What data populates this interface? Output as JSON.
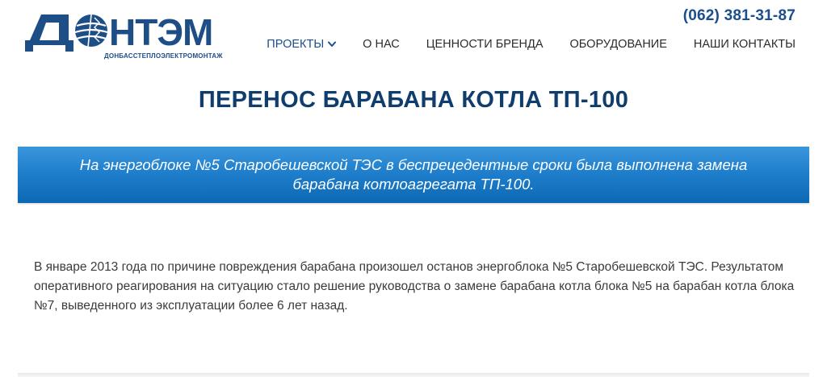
{
  "header": {
    "logo": {
      "wordmark": "ДОНТЭМ",
      "subtitle": "ДОНБАССТЕПЛОЭЛЕКТРОМОНТАЖ",
      "brand_color": "#1d4e85"
    },
    "phone": "(062) 381-31-87",
    "nav": [
      {
        "label": "ПРОЕКТЫ",
        "active": true,
        "icon": "chevron-down-icon"
      },
      {
        "label": "О НАС"
      },
      {
        "label": "ЦЕННОСТИ БРЕНДА"
      },
      {
        "label": "ОБОРУДОВАНИЕ"
      },
      {
        "label": "НАШИ КОНТАКТЫ"
      }
    ]
  },
  "main": {
    "title": "ПЕРЕНОС БАРАБАНА КОТЛА ТП-100",
    "banner": "На энергоблоке №5 Старобешевской ТЭС в беспрецедентные сроки была выполнена замена барабана котлоагрегата ТП-100.",
    "paragraph": "В январе 2013 года по причине повреждения барабана произошел останов энергоблока №5 Старобешевской ТЭС. Результатом оперативного реагирования на ситуацию стало решение руководства о замене барабана котла блока №5 на барабан котла блока №7, выведенного из эксплуатации более 6 лет назад."
  },
  "colors": {
    "accent": "#1a4e8c",
    "title": "#0f3d6e",
    "banner_top": "#3b97dc",
    "banner_bottom": "#0d68b4",
    "text": "#3b3b3b"
  }
}
